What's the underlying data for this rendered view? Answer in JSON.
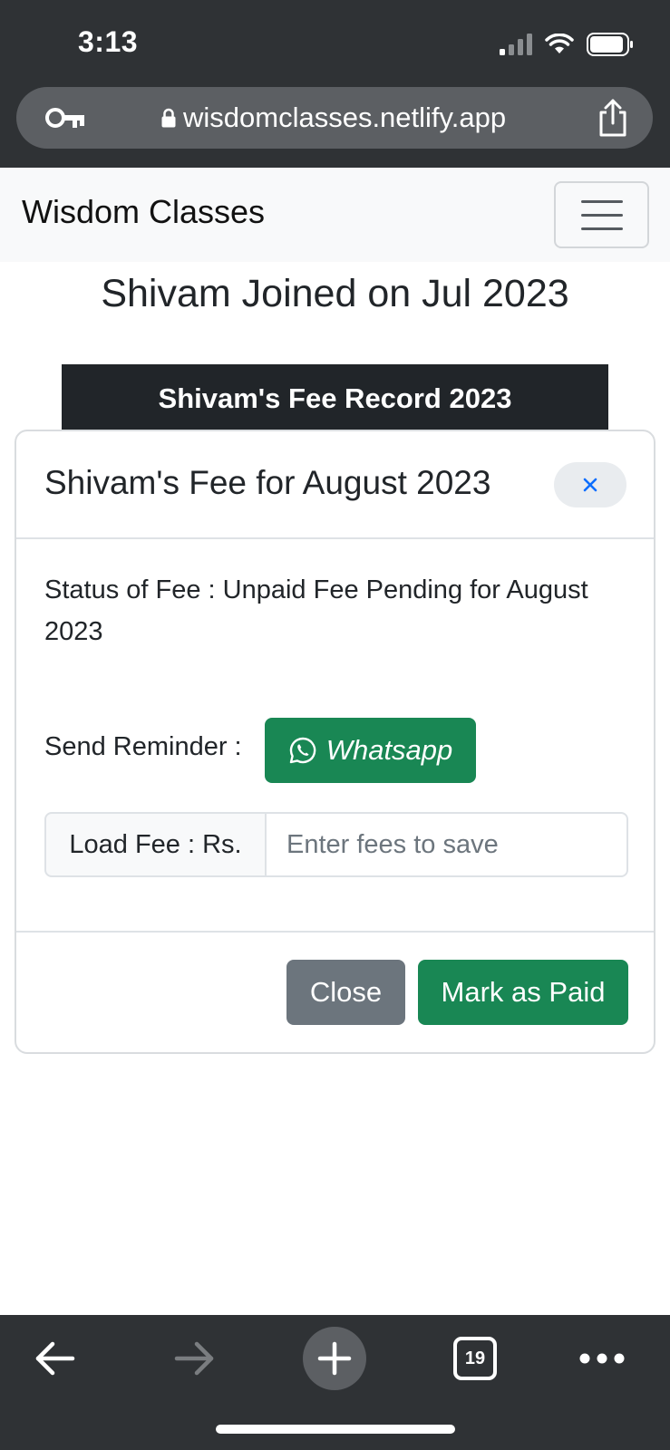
{
  "status_bar": {
    "time": "3:13"
  },
  "browser": {
    "url": "wisdomclasses.netlify.app",
    "tab_count": "19"
  },
  "navbar": {
    "brand": "Wisdom Classes"
  },
  "page": {
    "joined_heading": "Shivam Joined on Jul 2023",
    "record_title": "Shivam's Fee Record 2023"
  },
  "modal": {
    "title": "Shivam's Fee for August 2023",
    "status_text": "Status of Fee : Unpaid Fee Pending for August 2023",
    "reminder_label": "Send Reminder :",
    "whatsapp_label": "Whatsapp",
    "fee_prefix": "Load Fee : Rs.",
    "fee_input_value": "",
    "fee_input_placeholder": "Enter fees to save",
    "close_label": "Close",
    "mark_paid_label": "Mark as Paid"
  },
  "colors": {
    "browser_chrome": "#2f3235",
    "success": "#198754",
    "secondary": "#6c757d",
    "dark": "#212529"
  },
  "icons": {
    "status": [
      "signal-icon",
      "wifi-icon",
      "battery-icon"
    ],
    "url_bar": [
      "key-icon",
      "lock-icon",
      "share-icon"
    ],
    "toolbar": [
      "back-arrow-icon",
      "forward-arrow-icon",
      "plus-icon",
      "tabs-icon",
      "more-icon"
    ]
  }
}
